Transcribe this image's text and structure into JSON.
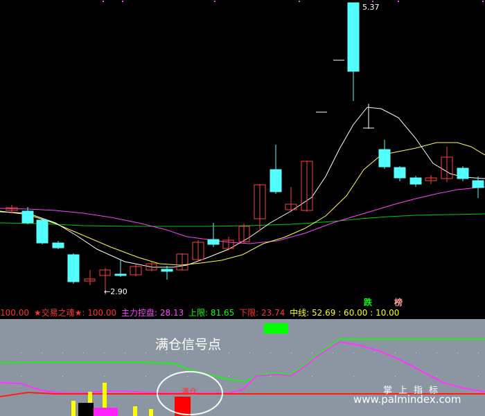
{
  "main_chart": {
    "low_marker": "←2.90",
    "high_marker": "5.37",
    "tag_down": "跌",
    "tag_rank": "榜"
  },
  "indicator_bar": {
    "items": [
      {
        "text": "100.00",
        "color": "#ff3030"
      },
      {
        "text": "★交易之魂★: 100.00",
        "color": "#ff3030"
      },
      {
        "text": "主力控盘: 28.13",
        "color": "#ff44ff"
      },
      {
        "text": "上限: 81.65",
        "color": "#00ff00"
      },
      {
        "text": "下限: 23.74",
        "color": "#ff3030"
      },
      {
        "text": "中线: 52.69 : 60.00 : 10.00",
        "color": "#ffff00"
      }
    ]
  },
  "sub_panel": {
    "title": "满仓信号点",
    "signal_label": "满仓",
    "watermark_cn": "掌上指标",
    "watermark_url": "www.palmindex.com"
  },
  "colors": {
    "bull": "#ff4040",
    "bear": "#54ffff",
    "ma_white": "#ffffff",
    "ma_yellow": "#ffff44",
    "ma_magenta": "#ff44ff",
    "ma_green": "#00cc00",
    "sub_bg": "#8c96a2"
  }
}
